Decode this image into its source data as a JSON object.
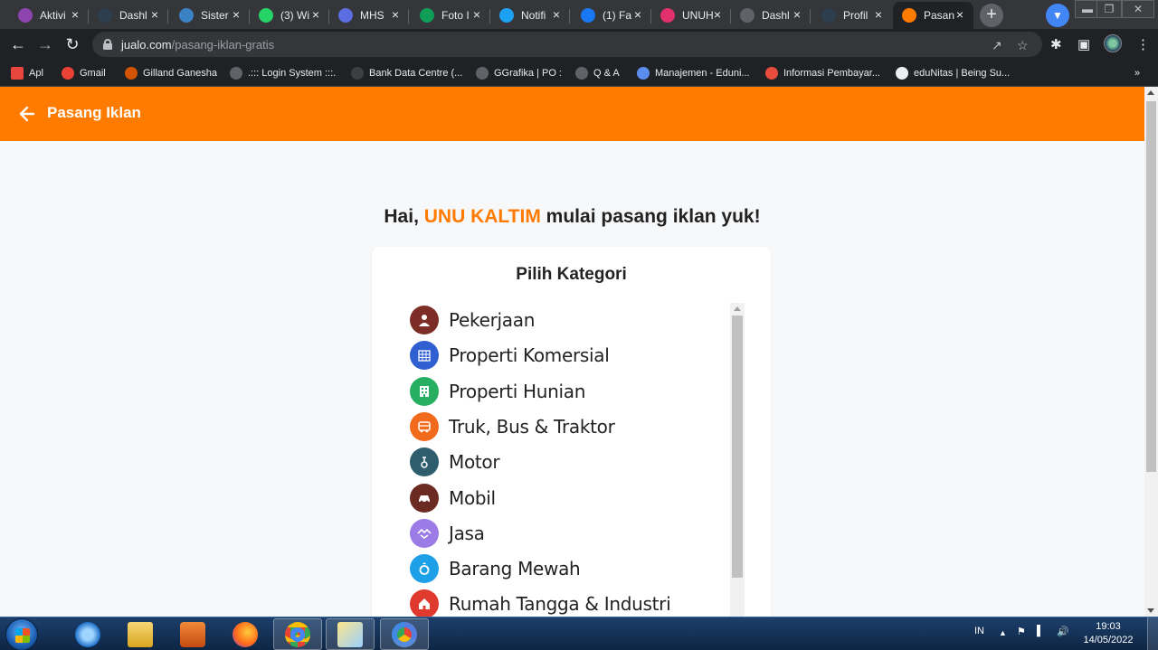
{
  "browser": {
    "tabs": [
      {
        "title": "Aktivi",
        "icon": "aktivitas-favicon",
        "color": "#8e44ad"
      },
      {
        "title": "Dashl",
        "icon": "dashboard-favicon",
        "color": "#2c3e50"
      },
      {
        "title": "Sister",
        "icon": "globe-favicon",
        "color": "#3b82c4"
      },
      {
        "title": "(3) Wi",
        "icon": "whatsapp-favicon",
        "color": "#25d366"
      },
      {
        "title": "MHS",
        "icon": "canva-favicon",
        "color": "#5b6ee1"
      },
      {
        "title": "Foto I",
        "icon": "sheets-favicon",
        "color": "#0f9d58"
      },
      {
        "title": "Notifi",
        "icon": "twitter-favicon",
        "color": "#1da1f2"
      },
      {
        "title": "(1) Fa",
        "icon": "facebook-favicon",
        "color": "#1877f2"
      },
      {
        "title": "UNUH",
        "icon": "instagram-favicon",
        "color": "#e1306c"
      },
      {
        "title": "Dashl",
        "icon": "dashboard-favicon",
        "color": "#5f6368"
      },
      {
        "title": "Profil",
        "icon": "profile-favicon",
        "color": "#2c3e50"
      },
      {
        "title": "Pasan",
        "icon": "jualo-favicon",
        "color": "#ff7b00"
      }
    ],
    "url_domain": "jualo.com",
    "url_path": "/pasang-iklan-gratis",
    "bookmarks": [
      {
        "label": "Apl",
        "color": "#e8453c"
      },
      {
        "label": "Gmail",
        "color": "#ea4335"
      },
      {
        "label": "Gilland Ganesha",
        "color": "#d35400"
      },
      {
        "label": ".::: Login System :::.",
        "color": "#5f6368"
      },
      {
        "label": "Bank Data Centre (...",
        "color": "#3c4043"
      },
      {
        "label": "GGrafika | PO :",
        "color": "#5f6368"
      },
      {
        "label": "Q & A",
        "color": "#5f6368"
      },
      {
        "label": "Manajemen - Eduni...",
        "color": "#5b8def"
      },
      {
        "label": "Informasi Pembayar...",
        "color": "#e74c3c"
      },
      {
        "label": "eduNitas | Being Su...",
        "color": "#ecf0f1"
      }
    ]
  },
  "page": {
    "header_title": "Pasang Iklan",
    "greeting_prefix": "Hai, ",
    "greeting_name": "UNU KALTIM",
    "greeting_suffix": " mulai pasang iklan yuk!",
    "card_title": "Pilih Kategori",
    "categories": [
      {
        "label": "Pekerjaan",
        "icon": "person-icon",
        "color": "#7b2d26"
      },
      {
        "label": "Properti Komersial",
        "icon": "building-grid-icon",
        "color": "#2f5fd0"
      },
      {
        "label": "Properti Hunian",
        "icon": "apartment-icon",
        "color": "#27ae60"
      },
      {
        "label": "Truk, Bus & Traktor",
        "icon": "bus-icon",
        "color": "#f26a1b"
      },
      {
        "label": "Motor",
        "icon": "motorcycle-icon",
        "color": "#2e5e6e"
      },
      {
        "label": "Mobil",
        "icon": "car-icon",
        "color": "#6b2a22"
      },
      {
        "label": "Jasa",
        "icon": "handshake-icon",
        "color": "#9b7be6"
      },
      {
        "label": "Barang Mewah",
        "icon": "ring-icon",
        "color": "#1ea0e8"
      },
      {
        "label": "Rumah Tangga & Industri",
        "icon": "house-icon",
        "color": "#e03a2f"
      }
    ]
  },
  "taskbar": {
    "language": "IN",
    "time": "19:03",
    "date": "14/05/2022"
  }
}
